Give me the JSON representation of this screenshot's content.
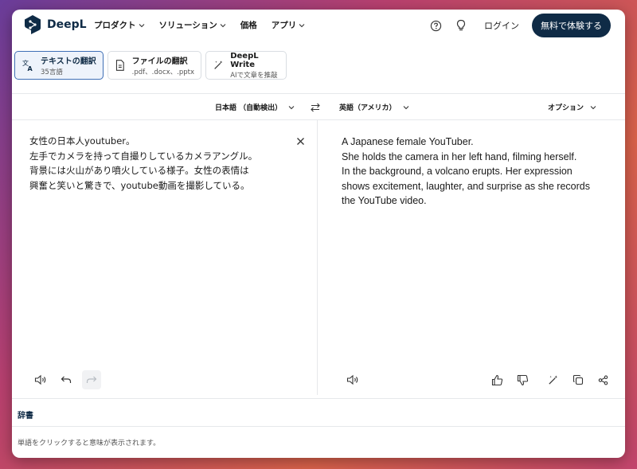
{
  "app": {
    "brand": "DeepL",
    "nav": [
      {
        "label": "プロダクト"
      },
      {
        "label": "ソリューション"
      },
      {
        "label": "価格"
      },
      {
        "label": "アプリ"
      }
    ],
    "login_label": "ログイン",
    "cta_label": "無料で体験する"
  },
  "modes": [
    {
      "title": "テキストの翻訳",
      "sub": "35言語"
    },
    {
      "title": "ファイルの翻訳",
      "sub": ".pdf、.docx、.pptx"
    },
    {
      "title": "DeepL Write",
      "sub": "AIで文章を推敲"
    }
  ],
  "langbar": {
    "source_lang": "日本語 （自動検出）",
    "target_lang": "英語（アメリカ）",
    "options_label": "オプション"
  },
  "source": {
    "lines": [
      "女性の日本人youtuber。",
      "左手でカメラを持って自撮りしているカメラアングル。",
      "背景には火山があり噴火している様子。女性の表情は",
      "興奮と笑いと驚きで、youtube動画を撮影している。"
    ]
  },
  "target": {
    "lines": [
      "A Japanese female YouTuber.",
      "She holds the camera in her left hand, filming herself.",
      "In the background, a volcano erupts. Her expression",
      "shows excitement, laughter, and surprise as she records",
      "the YouTube video."
    ]
  },
  "dictionary": {
    "title": "辞書",
    "hint": "単語をクリックすると意味が表示されます。"
  },
  "colors": {
    "brand_navy": "#0f2b46",
    "active_tab_border": "#3f6fb5"
  }
}
